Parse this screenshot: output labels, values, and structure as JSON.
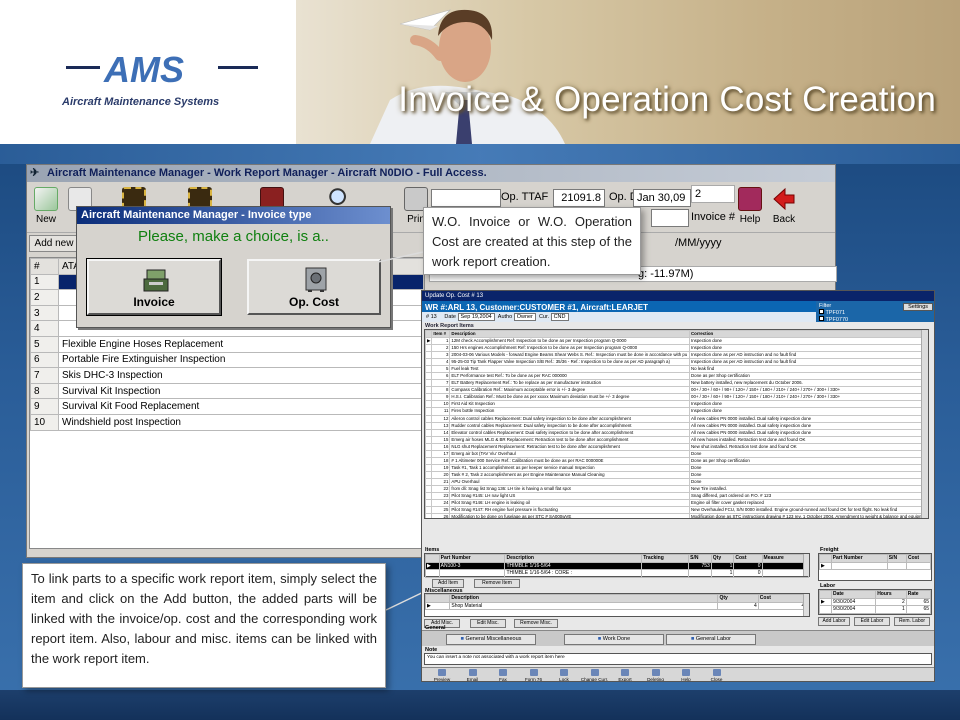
{
  "slide": {
    "title": "Invoice & Operation Cost Creation",
    "logo_text": "AMS",
    "logo_subtitle": "Aircraft Maintenance Systems"
  },
  "main_window": {
    "title": "Aircraft Maintenance Manager - Work Report Manager - Aircraft N0DIO - Full Access.",
    "toolbar": {
      "new_label": "New",
      "q_label": "Q",
      "print_label": "Prin",
      "help_label": "Help",
      "back_label": "Back"
    },
    "fields": {
      "op_ttaf_label": "Op. TTAF",
      "op_ttaf_value": "21091.8",
      "op_d_label": "Op. D.",
      "op_d_value": "Jan 30,09",
      "extra_value": "2",
      "invoice_label": "Invoice #"
    },
    "add_new_label": "Add new",
    "date_hint": "/MM/yyyy",
    "status_text": "g: -11.97M)",
    "grid": {
      "col_num": "#",
      "col_ata": "ATA",
      "rows": [
        {
          "num": "1",
          "desc": ""
        },
        {
          "num": "2",
          "desc": ""
        },
        {
          "num": "3",
          "desc": ""
        },
        {
          "num": "4",
          "desc": ""
        },
        {
          "num": "5",
          "desc": "Flexible Engine Hoses  Replacement"
        },
        {
          "num": "6",
          "desc": "Portable Fire Extinguisher  Inspection"
        },
        {
          "num": "7",
          "desc": "Skis DHC-3 Inspection"
        },
        {
          "num": "8",
          "desc": "Survival Kit  Inspection"
        },
        {
          "num": "9",
          "desc": "Survival Kit Food  Replacement"
        },
        {
          "num": "10",
          "desc": "Windshield post  Inspection"
        }
      ]
    }
  },
  "invoice_dialog": {
    "title": "Aircraft Maintenance Manager - Invoice type",
    "prompt": "Please, make a choice, is a..",
    "invoice_label": "Invoice",
    "opcost_label": "Op. Cost"
  },
  "callout_top": "W.O. Invoice or W.O. Operation Cost are created at this step of the work report creation.",
  "callout_bottom": "To link parts to a specific work report item, simply select the item and click on the Add button, the added parts will be linked with the invoice/op. cost and the corresponding work report item. Also, labour and misc. items can be linked with the work report item.",
  "update_window": {
    "title": "Update Op. Cost # 13",
    "heading": "WR #:ARL 13, Customer:CUSTOMER #1, Aircraft:LEARJET",
    "meta": {
      "num": "# 13",
      "date_label": "Date",
      "date_value": "Sep 19,2004",
      "auth_label": "Autho",
      "auth_value": "Owner",
      "cur_label": "Cur.",
      "cur_value": "CND"
    },
    "filter": {
      "label": "Filter",
      "settings": "Settings",
      "opt1": "TPF071",
      "opt2": "TPF0770"
    },
    "items_label": "Work Report Items",
    "items_cols": [
      "Item #",
      "Description",
      "Correction"
    ],
    "items": [
      {
        "n": "1",
        "d": "12M check Accomplishment Ref: Inspection to be done as per Inspection program Q-0000",
        "c": "Inspection done"
      },
      {
        "n": "2",
        "d": "150 Hrs engines Accomplishment Ref: Inspection to be done as per Inspection program Q-0000",
        "c": "Inspection done"
      },
      {
        "n": "3",
        "d": "2004-03-06 Various Models - forward Engine Beams Shear Webs S. Ref.: Inspection must be done in accordance with pu",
        "c": "Inspection done as per AD instruction and no fault find"
      },
      {
        "n": "4",
        "d": "95-25-03 Tip Tank Flapper Valve Inspection S/B Ref.: 35/36 - Ref.: Inspection to be done as per AD paragraph a)",
        "c": "Inspection done as per AD instruction and no fault find"
      },
      {
        "n": "5",
        "d": "Fuel leak   Test",
        "c": "No leak find"
      },
      {
        "n": "6",
        "d": "ELT   Performance test Ref.: To be done as per RAC 000000",
        "c": "Done as per Shop certification"
      },
      {
        "n": "7",
        "d": "ELT Battery   Replacement Ref.: To be replace as per manufacturer instruction",
        "c": "New battery installed, new replacement du October 2006."
      },
      {
        "n": "8",
        "d": "Compass   Calibration Ref.: Maximum acceptable error is +/- 3 degree",
        "c": "00+  / 30+  / 60+  / 90+  / 120+  / 150+  / 180+  / 210+  / 240+  / 270+  / 300+  / 330+"
      },
      {
        "n": "9",
        "d": "H.S.I.   Calibration Ref.: Must be done as per xxxxx Maximum deviation must be +/- 3 degree",
        "c": "00+  / 30+  / 60+  / 90+  / 120+  / 150+  / 180+  / 210+  / 240+  / 270+  / 300+  / 330+"
      },
      {
        "n": "10",
        "d": "First Aid Kit   Inspection",
        "c": "Inspection done"
      },
      {
        "n": "11",
        "d": "Fires bottle   Inspection",
        "c": "Inspection done"
      },
      {
        "n": "12",
        "d": "Aileron control cables   Replacement: Dual safety inspection to be done after accomplishment",
        "c": "All new cables PN 0000 installed. Dual safety inspection done"
      },
      {
        "n": "13",
        "d": "Rudder control cables   Replacement: Dual safety inspection to be done after accomplishment",
        "c": "All new cables PN 0000 installed. Dual safety inspection done"
      },
      {
        "n": "14",
        "d": "Elevator control cables   Replacement: Dual safety inspection to be done after accomplishment",
        "c": "All new cables PN 0000 installed. Dual safety inspection done"
      },
      {
        "n": "15",
        "d": "Emerg air hoses MLG & BR   Replacement: Retraction test to be done after accomplishment",
        "c": "All new hoses installed. Retraction test done and found OK"
      },
      {
        "n": "16",
        "d": "NLG shut   Replacement Replacement: Retraction test to be done after accomplishment",
        "c": "New shut installed. Retraction test done and found OK"
      },
      {
        "n": "17",
        "d": "Emerg air bot (TAV Viu'   Overhaul",
        "c": "Done"
      },
      {
        "n": "18",
        "d": "# 1 Altimeter  000 Service Ref.: Calibration must be done as per RAC 000000E",
        "c": "Done as per Shop certification"
      },
      {
        "n": "19",
        "d": "Task #1, Task 1 accomplishment as per keeper service manual Inspection",
        "c": "Done"
      },
      {
        "n": "20",
        "d": "Task # 2, Task 2 accomplishment as per Engine Maintenance Manual Cleaning",
        "c": "Done"
      },
      {
        "n": "21",
        "d": "APU Overhaul",
        "c": "Done"
      },
      {
        "n": "22",
        "d": "from dli: Snag list Snag 136: LH tire is having a small flat spot",
        "c": "New Tire installed."
      },
      {
        "n": "23",
        "d": "Pilot Snag #145: LH nav light US",
        "c": "Snag differed, part ordered on P.O. # 123"
      },
      {
        "n": "24",
        "d": "Pilot Snag #146: LH engine is leaking oil",
        "c": "Engine oil filter cover gasket replaced"
      },
      {
        "n": "25",
        "d": "Pilot Snag #147: RH engine fuel pressure is fluctuating",
        "c": "New Overhauled FCU, S/N 0000 installed. Engine ground-runned and found OK for test flight. No leak find"
      },
      {
        "n": "26",
        "d": "Modification to be done on fuselage as per STC # SA000wVE",
        "c": "Modification done as STC instructions drawing # 123 rev. 1 October 2004. Amendment to weight & balance and equipme"
      }
    ],
    "parts": {
      "label": "Items",
      "cols": [
        "Part Number",
        "Description",
        "Tracking",
        "S/N",
        "Qty",
        "Cost",
        "Measure"
      ],
      "rows": [
        {
          "pn": "AN100-3",
          "desc": "THIMBLE 1/16-5/64",
          "tr": "",
          "sn": "753",
          "qty": "1",
          "cost": "0",
          "m": ""
        },
        {
          "pn": "",
          "desc": "THIMBLE 1/16-5/64 : CORE :",
          "tr": "",
          "sn": "",
          "qty": "1",
          "cost": "0",
          "m": ""
        }
      ],
      "add_label": "Add Item",
      "remove_label": "Remove Item"
    },
    "misc": {
      "label": "Miscellaneous",
      "cols": [
        "Description",
        "Qty",
        "Cost"
      ],
      "rows": [
        {
          "d": "Shop Material",
          "q": "4",
          "c": "43"
        }
      ],
      "add_label": "Add Misc.",
      "edit_label": "Edit Misc.",
      "remove_label": "Remove Misc."
    },
    "freight": {
      "label": "Freight",
      "cols": [
        "Part Number",
        "S/N",
        "Cost"
      ]
    },
    "labor": {
      "label": "Labor",
      "cols": [
        "Date",
        "Hours",
        "Rate"
      ],
      "rows": [
        {
          "d": "9/30/2004",
          "h": "2",
          "r": "65"
        },
        {
          "d": "9/30/2004",
          "h": "1",
          "r": "65"
        }
      ],
      "add_label": "Add Labor",
      "edit_label": "Edit Labor",
      "remove_label": "Rem. Labor"
    },
    "general": {
      "label": "General",
      "misc_tab": "General Miscellaneous",
      "work_tab": "Work Done",
      "labor_tab": "General Labor"
    },
    "note": {
      "label": "Note",
      "text": "You can insert a note not associated with a work report item here"
    },
    "bottom": [
      "Preview",
      "Email",
      "Fax",
      "Form 76",
      "Lock",
      "Change Curr.",
      "Export",
      "Deleting",
      "Help",
      "Close"
    ]
  }
}
